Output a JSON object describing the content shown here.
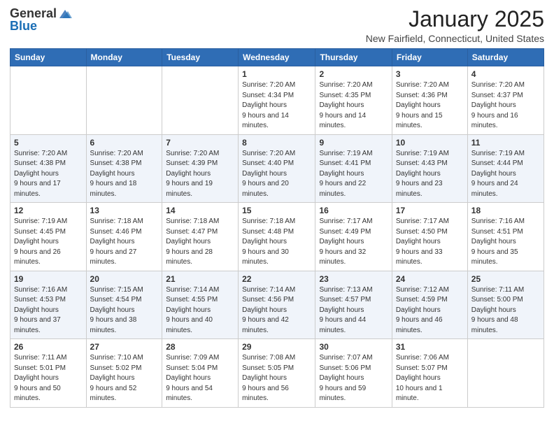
{
  "logo": {
    "general": "General",
    "blue": "Blue"
  },
  "title": "January 2025",
  "location": "New Fairfield, Connecticut, United States",
  "days_of_week": [
    "Sunday",
    "Monday",
    "Tuesday",
    "Wednesday",
    "Thursday",
    "Friday",
    "Saturday"
  ],
  "weeks": [
    [
      {
        "day": "",
        "sunrise": "",
        "sunset": "",
        "daylight": ""
      },
      {
        "day": "",
        "sunrise": "",
        "sunset": "",
        "daylight": ""
      },
      {
        "day": "",
        "sunrise": "",
        "sunset": "",
        "daylight": ""
      },
      {
        "day": "1",
        "sunrise": "7:20 AM",
        "sunset": "4:34 PM",
        "daylight": "9 hours and 14 minutes."
      },
      {
        "day": "2",
        "sunrise": "7:20 AM",
        "sunset": "4:35 PM",
        "daylight": "9 hours and 14 minutes."
      },
      {
        "day": "3",
        "sunrise": "7:20 AM",
        "sunset": "4:36 PM",
        "daylight": "9 hours and 15 minutes."
      },
      {
        "day": "4",
        "sunrise": "7:20 AM",
        "sunset": "4:37 PM",
        "daylight": "9 hours and 16 minutes."
      }
    ],
    [
      {
        "day": "5",
        "sunrise": "7:20 AM",
        "sunset": "4:38 PM",
        "daylight": "9 hours and 17 minutes."
      },
      {
        "day": "6",
        "sunrise": "7:20 AM",
        "sunset": "4:38 PM",
        "daylight": "9 hours and 18 minutes."
      },
      {
        "day": "7",
        "sunrise": "7:20 AM",
        "sunset": "4:39 PM",
        "daylight": "9 hours and 19 minutes."
      },
      {
        "day": "8",
        "sunrise": "7:20 AM",
        "sunset": "4:40 PM",
        "daylight": "9 hours and 20 minutes."
      },
      {
        "day": "9",
        "sunrise": "7:19 AM",
        "sunset": "4:41 PM",
        "daylight": "9 hours and 22 minutes."
      },
      {
        "day": "10",
        "sunrise": "7:19 AM",
        "sunset": "4:43 PM",
        "daylight": "9 hours and 23 minutes."
      },
      {
        "day": "11",
        "sunrise": "7:19 AM",
        "sunset": "4:44 PM",
        "daylight": "9 hours and 24 minutes."
      }
    ],
    [
      {
        "day": "12",
        "sunrise": "7:19 AM",
        "sunset": "4:45 PM",
        "daylight": "9 hours and 26 minutes."
      },
      {
        "day": "13",
        "sunrise": "7:18 AM",
        "sunset": "4:46 PM",
        "daylight": "9 hours and 27 minutes."
      },
      {
        "day": "14",
        "sunrise": "7:18 AM",
        "sunset": "4:47 PM",
        "daylight": "9 hours and 28 minutes."
      },
      {
        "day": "15",
        "sunrise": "7:18 AM",
        "sunset": "4:48 PM",
        "daylight": "9 hours and 30 minutes."
      },
      {
        "day": "16",
        "sunrise": "7:17 AM",
        "sunset": "4:49 PM",
        "daylight": "9 hours and 32 minutes."
      },
      {
        "day": "17",
        "sunrise": "7:17 AM",
        "sunset": "4:50 PM",
        "daylight": "9 hours and 33 minutes."
      },
      {
        "day": "18",
        "sunrise": "7:16 AM",
        "sunset": "4:51 PM",
        "daylight": "9 hours and 35 minutes."
      }
    ],
    [
      {
        "day": "19",
        "sunrise": "7:16 AM",
        "sunset": "4:53 PM",
        "daylight": "9 hours and 37 minutes."
      },
      {
        "day": "20",
        "sunrise": "7:15 AM",
        "sunset": "4:54 PM",
        "daylight": "9 hours and 38 minutes."
      },
      {
        "day": "21",
        "sunrise": "7:14 AM",
        "sunset": "4:55 PM",
        "daylight": "9 hours and 40 minutes."
      },
      {
        "day": "22",
        "sunrise": "7:14 AM",
        "sunset": "4:56 PM",
        "daylight": "9 hours and 42 minutes."
      },
      {
        "day": "23",
        "sunrise": "7:13 AM",
        "sunset": "4:57 PM",
        "daylight": "9 hours and 44 minutes."
      },
      {
        "day": "24",
        "sunrise": "7:12 AM",
        "sunset": "4:59 PM",
        "daylight": "9 hours and 46 minutes."
      },
      {
        "day": "25",
        "sunrise": "7:11 AM",
        "sunset": "5:00 PM",
        "daylight": "9 hours and 48 minutes."
      }
    ],
    [
      {
        "day": "26",
        "sunrise": "7:11 AM",
        "sunset": "5:01 PM",
        "daylight": "9 hours and 50 minutes."
      },
      {
        "day": "27",
        "sunrise": "7:10 AM",
        "sunset": "5:02 PM",
        "daylight": "9 hours and 52 minutes."
      },
      {
        "day": "28",
        "sunrise": "7:09 AM",
        "sunset": "5:04 PM",
        "daylight": "9 hours and 54 minutes."
      },
      {
        "day": "29",
        "sunrise": "7:08 AM",
        "sunset": "5:05 PM",
        "daylight": "9 hours and 56 minutes."
      },
      {
        "day": "30",
        "sunrise": "7:07 AM",
        "sunset": "5:06 PM",
        "daylight": "9 hours and 59 minutes."
      },
      {
        "day": "31",
        "sunrise": "7:06 AM",
        "sunset": "5:07 PM",
        "daylight": "10 hours and 1 minute."
      },
      {
        "day": "",
        "sunrise": "",
        "sunset": "",
        "daylight": ""
      }
    ]
  ]
}
